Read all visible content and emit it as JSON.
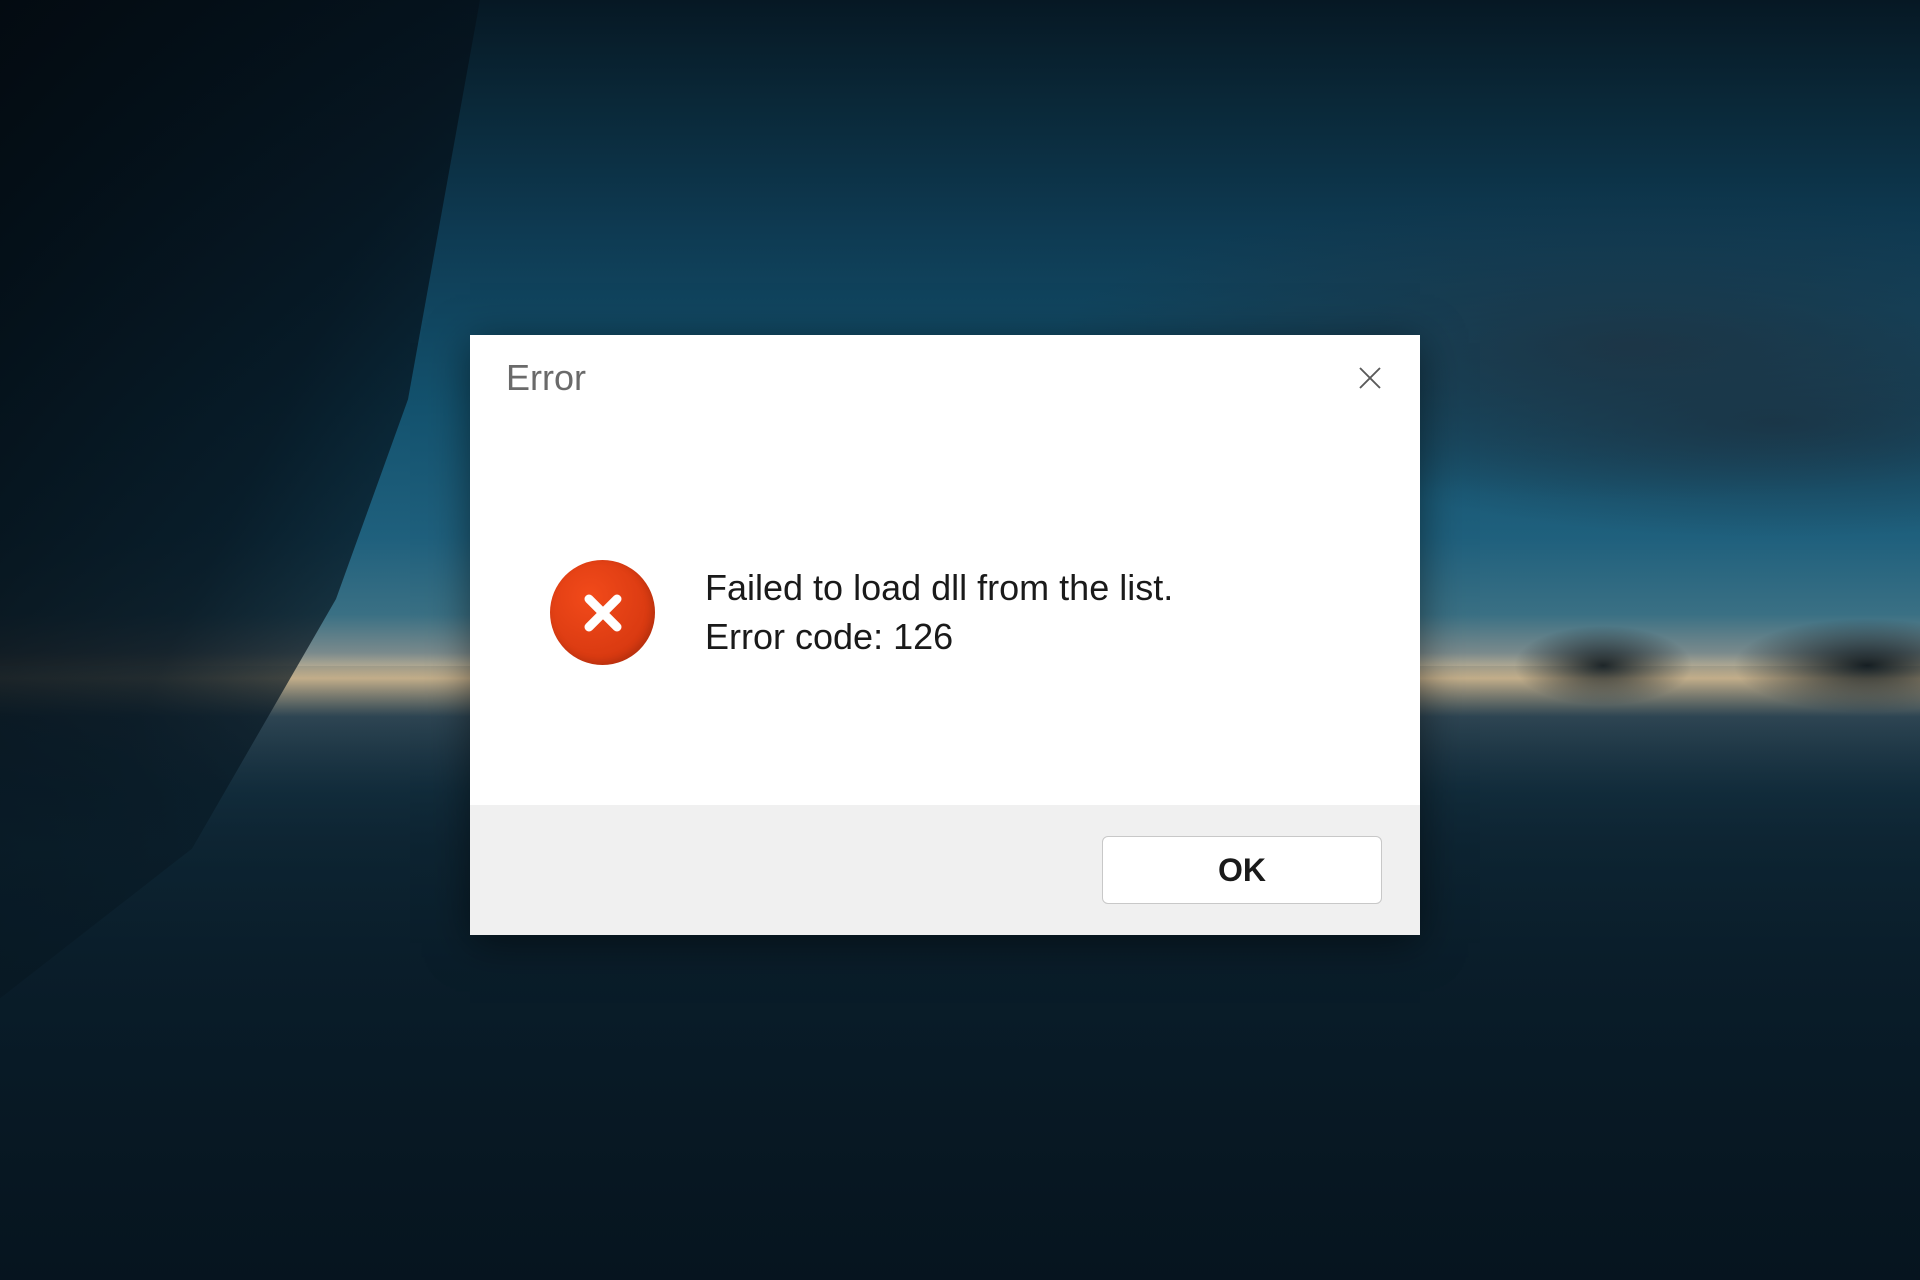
{
  "dialog": {
    "title": "Error",
    "message_line1": "Failed to load dll from the list.",
    "message_line2": "Error code: 126",
    "ok_label": "OK"
  }
}
